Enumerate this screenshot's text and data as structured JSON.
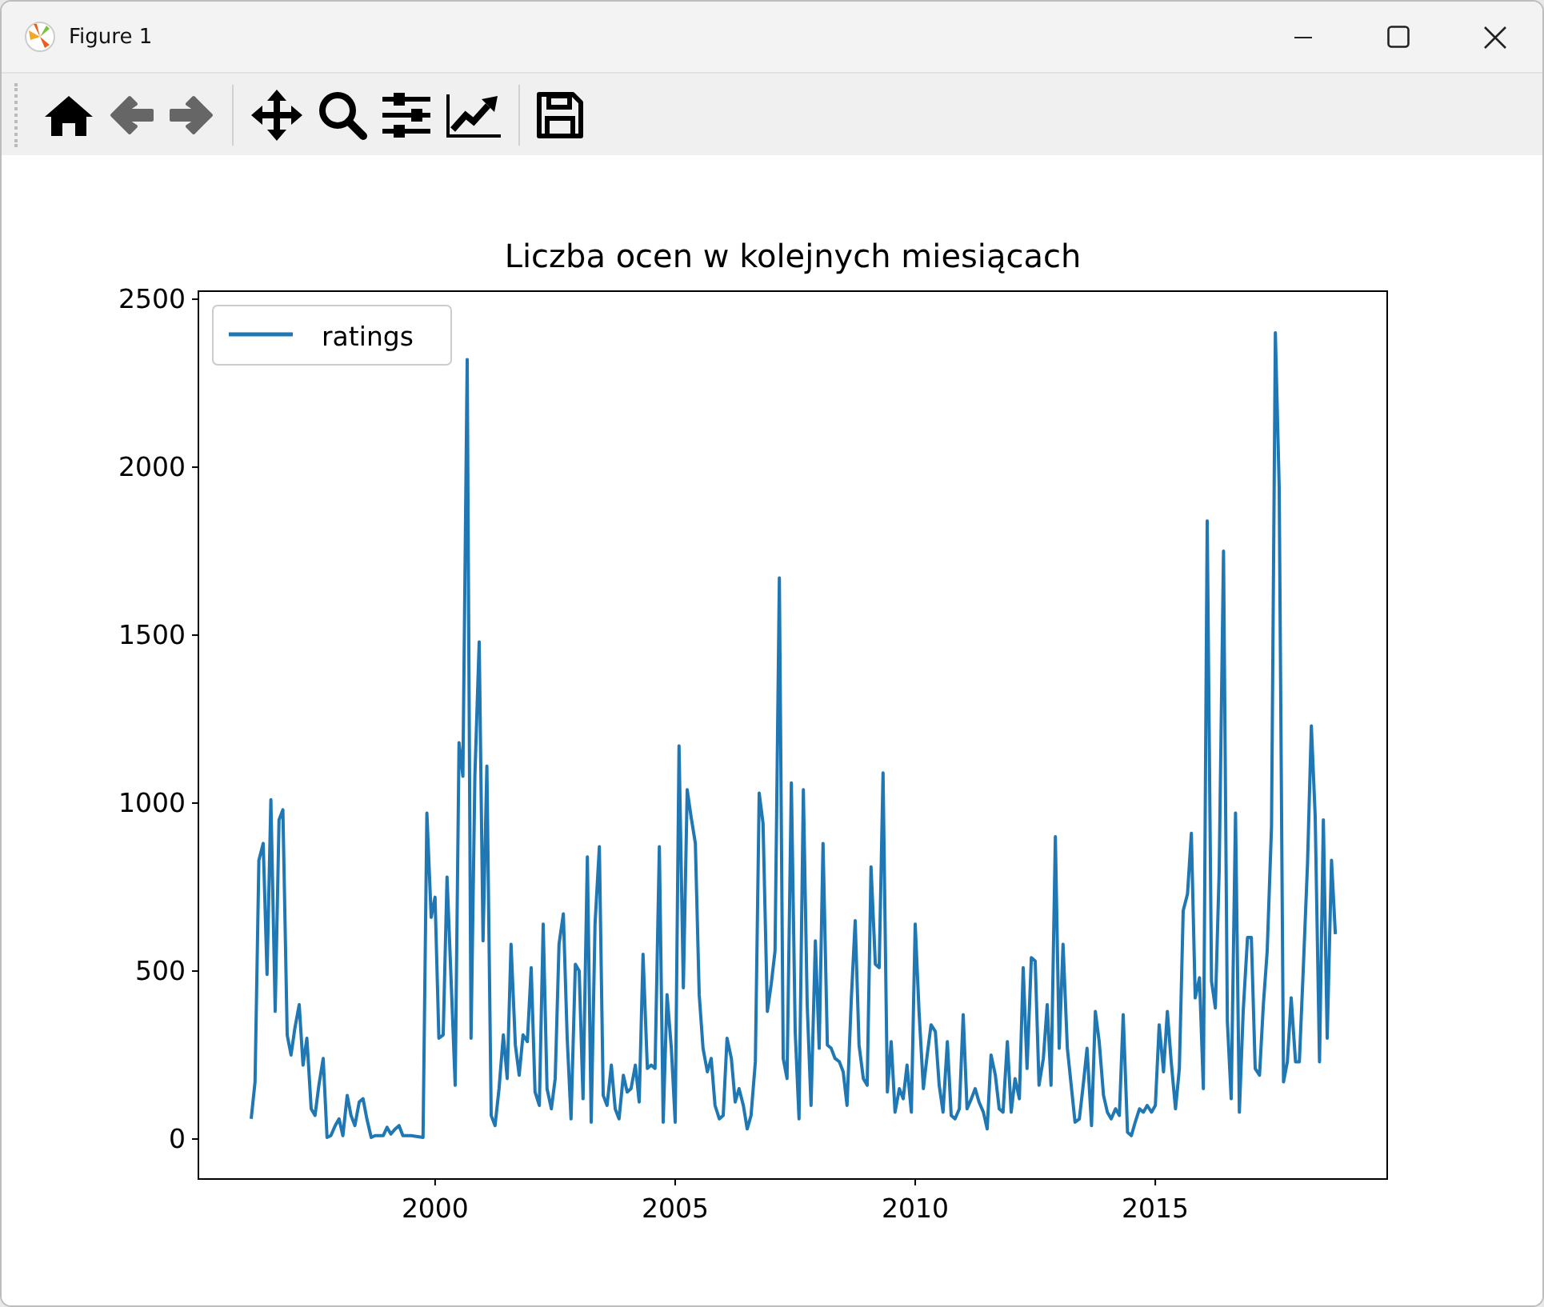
{
  "window": {
    "title": "Figure 1"
  },
  "toolbar": [
    [
      {
        "kind": "home",
        "disabled": false
      },
      {
        "kind": "back",
        "disabled": true
      },
      {
        "kind": "forward",
        "disabled": true
      }
    ],
    [
      {
        "kind": "pan",
        "disabled": false
      },
      {
        "kind": "zoom",
        "disabled": false
      },
      {
        "kind": "subplots",
        "disabled": false
      },
      {
        "kind": "edit",
        "disabled": false
      }
    ],
    [
      {
        "kind": "save",
        "disabled": false
      }
    ]
  ],
  "figure": {
    "chart_data": {
      "type": "line",
      "title": "Liczba ocen w kolejnych miesiącach",
      "xlim": [
        1995.07,
        2019.83
      ],
      "ylim": [
        -119,
        2524
      ],
      "xticks": [
        2000,
        2005,
        2010,
        2015
      ],
      "yticks": [
        0,
        500,
        1000,
        1500,
        2000,
        2500
      ],
      "x": [
        1996.17,
        1996.25,
        1996.33,
        1996.42,
        1996.5,
        1996.58,
        1996.67,
        1996.75,
        1996.83,
        1996.92,
        1997,
        1997.08,
        1997.17,
        1997.25,
        1997.33,
        1997.42,
        1997.5,
        1997.58,
        1997.67,
        1997.75,
        1997.83,
        1997.92,
        1998,
        1998.08,
        1998.17,
        1998.25,
        1998.33,
        1998.42,
        1998.5,
        1998.58,
        1998.67,
        1998.75,
        1998.83,
        1998.92,
        1999,
        1999.08,
        1999.17,
        1999.25,
        1999.33,
        1999.5,
        1999.75,
        1999.83,
        1999.92,
        2000,
        2000.08,
        2000.17,
        2000.25,
        2000.33,
        2000.42,
        2000.5,
        2000.58,
        2000.67,
        2000.75,
        2000.83,
        2000.92,
        2001,
        2001.08,
        2001.17,
        2001.25,
        2001.33,
        2001.42,
        2001.5,
        2001.58,
        2001.67,
        2001.75,
        2001.83,
        2001.92,
        2002,
        2002.08,
        2002.17,
        2002.25,
        2002.33,
        2002.42,
        2002.5,
        2002.58,
        2002.67,
        2002.75,
        2002.83,
        2002.92,
        2003,
        2003.08,
        2003.17,
        2003.25,
        2003.33,
        2003.42,
        2003.5,
        2003.58,
        2003.67,
        2003.75,
        2003.83,
        2003.92,
        2004,
        2004.08,
        2004.17,
        2004.25,
        2004.33,
        2004.42,
        2004.5,
        2004.58,
        2004.67,
        2004.75,
        2004.83,
        2004.92,
        2005,
        2005.08,
        2005.17,
        2005.25,
        2005.33,
        2005.42,
        2005.5,
        2005.58,
        2005.67,
        2005.75,
        2005.83,
        2005.92,
        2006,
        2006.08,
        2006.17,
        2006.25,
        2006.33,
        2006.42,
        2006.5,
        2006.58,
        2006.67,
        2006.75,
        2006.83,
        2006.92,
        2007,
        2007.08,
        2007.17,
        2007.25,
        2007.33,
        2007.42,
        2007.5,
        2007.58,
        2007.67,
        2007.75,
        2007.83,
        2007.92,
        2008,
        2008.08,
        2008.17,
        2008.25,
        2008.33,
        2008.42,
        2008.5,
        2008.58,
        2008.67,
        2008.75,
        2008.83,
        2008.92,
        2009,
        2009.08,
        2009.17,
        2009.25,
        2009.33,
        2009.42,
        2009.5,
        2009.58,
        2009.67,
        2009.75,
        2009.83,
        2009.92,
        2010,
        2010.08,
        2010.17,
        2010.25,
        2010.33,
        2010.42,
        2010.5,
        2010.58,
        2010.67,
        2010.75,
        2010.83,
        2010.92,
        2011,
        2011.08,
        2011.17,
        2011.25,
        2011.33,
        2011.42,
        2011.5,
        2011.58,
        2011.67,
        2011.75,
        2011.83,
        2011.92,
        2012,
        2012.08,
        2012.17,
        2012.25,
        2012.33,
        2012.42,
        2012.5,
        2012.58,
        2012.67,
        2012.75,
        2012.83,
        2012.92,
        2013,
        2013.08,
        2013.17,
        2013.25,
        2013.33,
        2013.42,
        2013.5,
        2013.58,
        2013.67,
        2013.75,
        2013.83,
        2013.92,
        2014,
        2014.08,
        2014.17,
        2014.25,
        2014.33,
        2014.42,
        2014.5,
        2014.58,
        2014.67,
        2014.75,
        2014.83,
        2014.92,
        2015,
        2015.08,
        2015.17,
        2015.25,
        2015.33,
        2015.42,
        2015.5,
        2015.58,
        2015.67,
        2015.75,
        2015.83,
        2015.92,
        2016,
        2016.08,
        2016.17,
        2016.25,
        2016.33,
        2016.42,
        2016.5,
        2016.58,
        2016.67,
        2016.75,
        2016.83,
        2016.92,
        2017,
        2017.08,
        2017.17,
        2017.25,
        2017.33,
        2017.42,
        2017.5,
        2017.58,
        2017.67,
        2017.75,
        2017.83,
        2017.92,
        2018,
        2018.08,
        2018.17,
        2018.25,
        2018.33,
        2018.42,
        2018.5,
        2018.58,
        2018.67,
        2018.75
      ],
      "series": [
        {
          "name": "ratings",
          "color": "#1f77b4",
          "values": [
            60,
            170,
            830,
            880,
            490,
            1010,
            380,
            950,
            980,
            310,
            250,
            330,
            400,
            220,
            300,
            90,
            70,
            160,
            240,
            5,
            10,
            40,
            60,
            10,
            130,
            70,
            40,
            110,
            120,
            60,
            5,
            10,
            10,
            10,
            35,
            15,
            30,
            40,
            10,
            10,
            5,
            970,
            660,
            720,
            300,
            310,
            780,
            490,
            160,
            1180,
            1080,
            2320,
            300,
            1080,
            1480,
            590,
            1110,
            70,
            40,
            150,
            310,
            180,
            580,
            280,
            190,
            310,
            290,
            510,
            140,
            100,
            640,
            150,
            90,
            180,
            580,
            670,
            300,
            60,
            520,
            500,
            120,
            840,
            50,
            640,
            870,
            130,
            100,
            220,
            90,
            60,
            190,
            140,
            150,
            220,
            110,
            550,
            210,
            220,
            210,
            870,
            50,
            430,
            270,
            50,
            1170,
            450,
            1040,
            960,
            880,
            430,
            270,
            200,
            240,
            100,
            60,
            70,
            300,
            240,
            110,
            150,
            100,
            30,
            70,
            230,
            1030,
            940,
            380,
            460,
            560,
            1670,
            240,
            180,
            1060,
            320,
            60,
            1040,
            400,
            100,
            590,
            270,
            880,
            280,
            270,
            240,
            230,
            200,
            100,
            420,
            650,
            280,
            180,
            160,
            810,
            520,
            510,
            1090,
            140,
            290,
            80,
            150,
            120,
            220,
            80,
            640,
            380,
            150,
            250,
            340,
            320,
            160,
            80,
            290,
            70,
            60,
            90,
            370,
            90,
            120,
            150,
            110,
            80,
            30,
            250,
            190,
            90,
            80,
            290,
            80,
            180,
            120,
            510,
            210,
            540,
            530,
            160,
            240,
            400,
            160,
            900,
            270,
            580,
            270,
            160,
            50,
            60,
            160,
            270,
            40,
            380,
            290,
            130,
            80,
            60,
            90,
            70,
            370,
            20,
            10,
            50,
            90,
            80,
            100,
            80,
            100,
            340,
            200,
            380,
            230,
            90,
            210,
            680,
            730,
            910,
            420,
            480,
            150,
            1840,
            470,
            390,
            800,
            1750,
            350,
            120,
            970,
            80,
            380,
            600,
            600,
            210,
            190,
            400,
            560,
            930,
            2400,
            1940,
            170,
            230,
            420,
            230,
            230,
            500,
            820,
            1230,
            960,
            230,
            950,
            300,
            830,
            610
          ]
        }
      ]
    }
  }
}
